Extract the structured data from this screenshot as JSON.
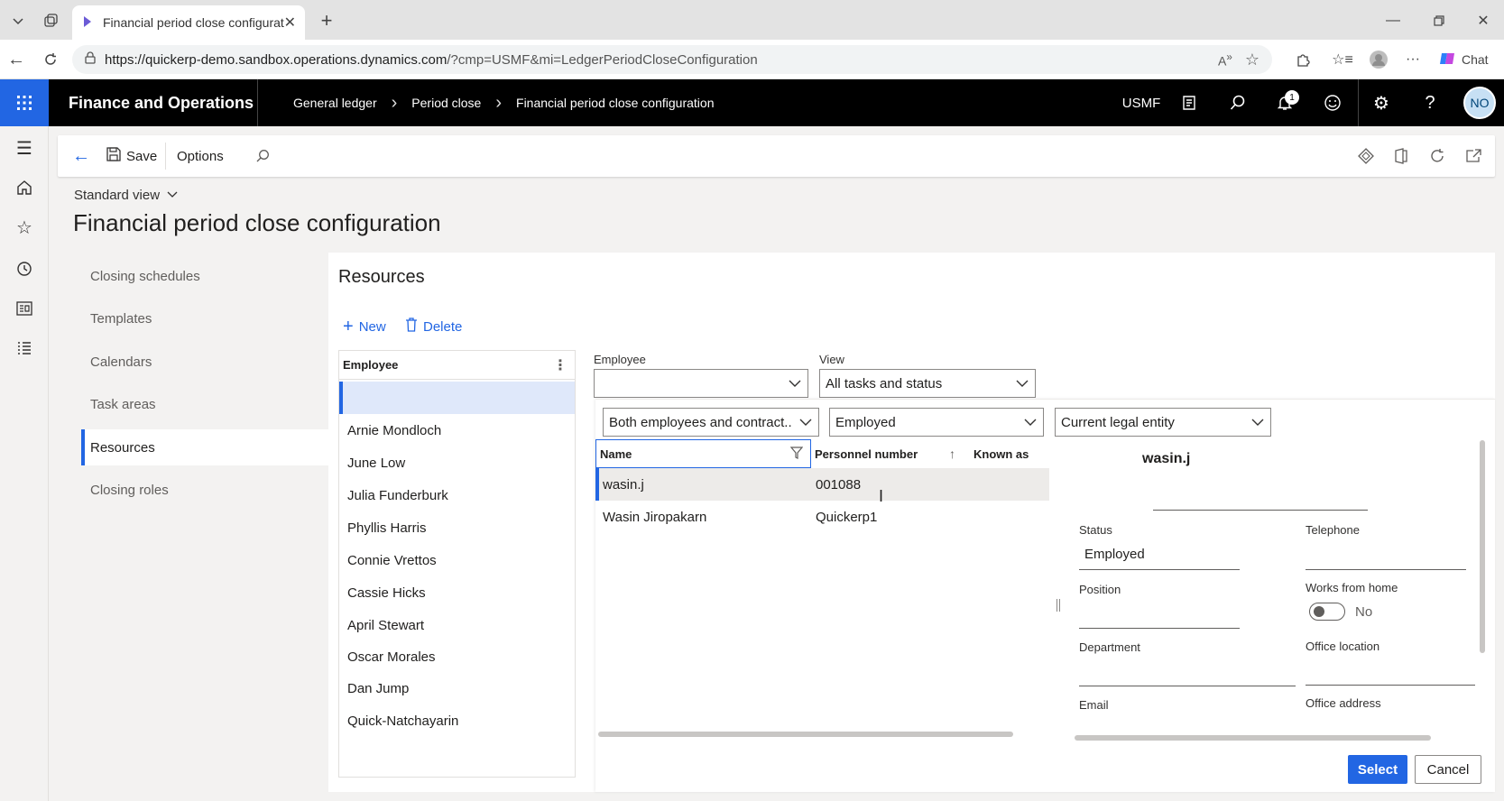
{
  "browser": {
    "tab_title": "Financial period close configuratio",
    "url_host": "https://quickerp-demo.sandbox.operations.dynamics.com",
    "url_path": "/?cmp=USMF&mi=LedgerPeriodCloseConfiguration",
    "chat_label": "Chat",
    "notification_count": "1"
  },
  "header": {
    "app_title": "Finance and Operations",
    "breadcrumbs": [
      "General ledger",
      "Period close",
      "Financial period close configuration"
    ],
    "company": "USMF",
    "avatar_initials": "NO"
  },
  "action_pane": {
    "save_label": "Save",
    "options_label": "Options"
  },
  "page": {
    "view_selector": "Standard view",
    "title": "Financial period close configuration"
  },
  "tabs": [
    {
      "label": "Closing schedules"
    },
    {
      "label": "Templates"
    },
    {
      "label": "Calendars"
    },
    {
      "label": "Task areas"
    },
    {
      "label": "Resources",
      "selected": true
    },
    {
      "label": "Closing roles"
    }
  ],
  "resources": {
    "section_title": "Resources",
    "new_label": "New",
    "delete_label": "Delete",
    "grid_header": "Employee",
    "employees": [
      "Arnie Mondloch",
      "June Low",
      "Julia Funderburk",
      "Phyllis Harris",
      "Connie Vrettos",
      "Cassie Hicks",
      "April Stewart",
      "Oscar Morales",
      "Dan Jump",
      "Quick-Natchayarin"
    ]
  },
  "lookup": {
    "employee_label": "Employee",
    "employee_value": "",
    "view_label": "View",
    "view_value": "All tasks and status",
    "filter_type": "Both employees and contract...",
    "filter_status": "Employed",
    "filter_entity": "Current legal entity",
    "columns": {
      "name": "Name",
      "personnel": "Personnel number",
      "known_as": "Known as"
    },
    "rows": [
      {
        "name": "wasin.j",
        "personnel": "001088",
        "known_as": ""
      },
      {
        "name": "Wasin Jiropakarn",
        "personnel": "Quickerp1",
        "known_as": ""
      }
    ],
    "detail": {
      "name": "wasin.j",
      "status_label": "Status",
      "status_value": "Employed",
      "telephone_label": "Telephone",
      "position_label": "Position",
      "works_from_home_label": "Works from home",
      "works_from_home_value": "No",
      "department_label": "Department",
      "office_location_label": "Office location",
      "email_label": "Email",
      "office_address_label": "Office address"
    },
    "select_label": "Select",
    "cancel_label": "Cancel"
  }
}
